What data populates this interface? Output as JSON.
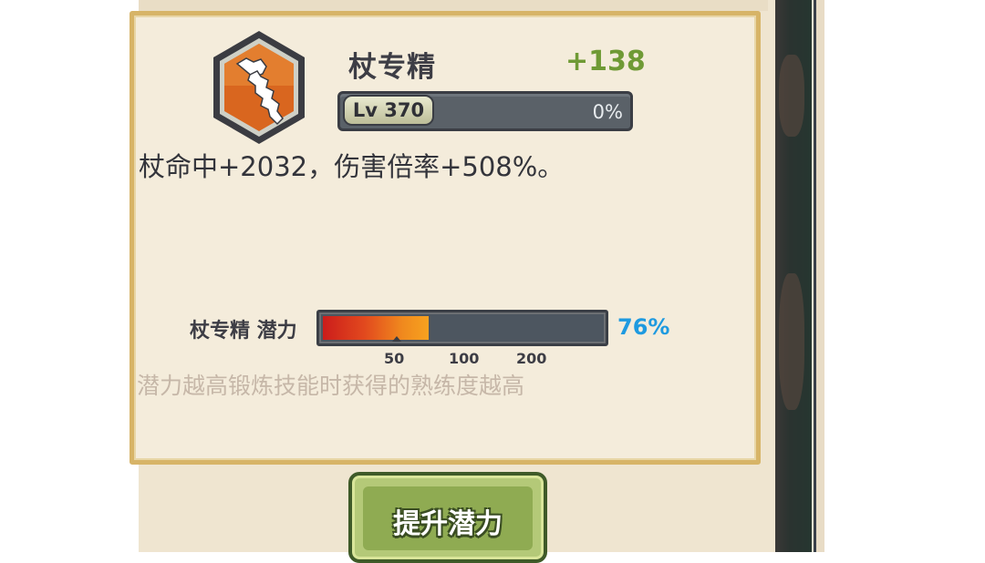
{
  "skill": {
    "name": "杖专精",
    "bonus": "+138",
    "icon": "staff-icon",
    "level": "Lv 370",
    "exp_percent_label": "0%",
    "exp_progress": 0,
    "description": "杖命中+2032，伤害倍率+508%。"
  },
  "potential": {
    "label": "杖专精 潜力",
    "percent_label": "76%",
    "ticks": [
      "50",
      "100",
      "200"
    ],
    "hint": "潜力越高锻炼技能时获得的熟练度越高",
    "fill_percent": 38
  },
  "actions": {
    "upgrade_label": "提升潜力"
  },
  "colors": {
    "panel_bg": "#f4ecdb",
    "panel_border": "#d7b467",
    "bonus_green": "#6f9a35",
    "percent_blue": "#1e9ae0",
    "button_green": "#8fab52",
    "icon_orange": "#d9661f"
  }
}
